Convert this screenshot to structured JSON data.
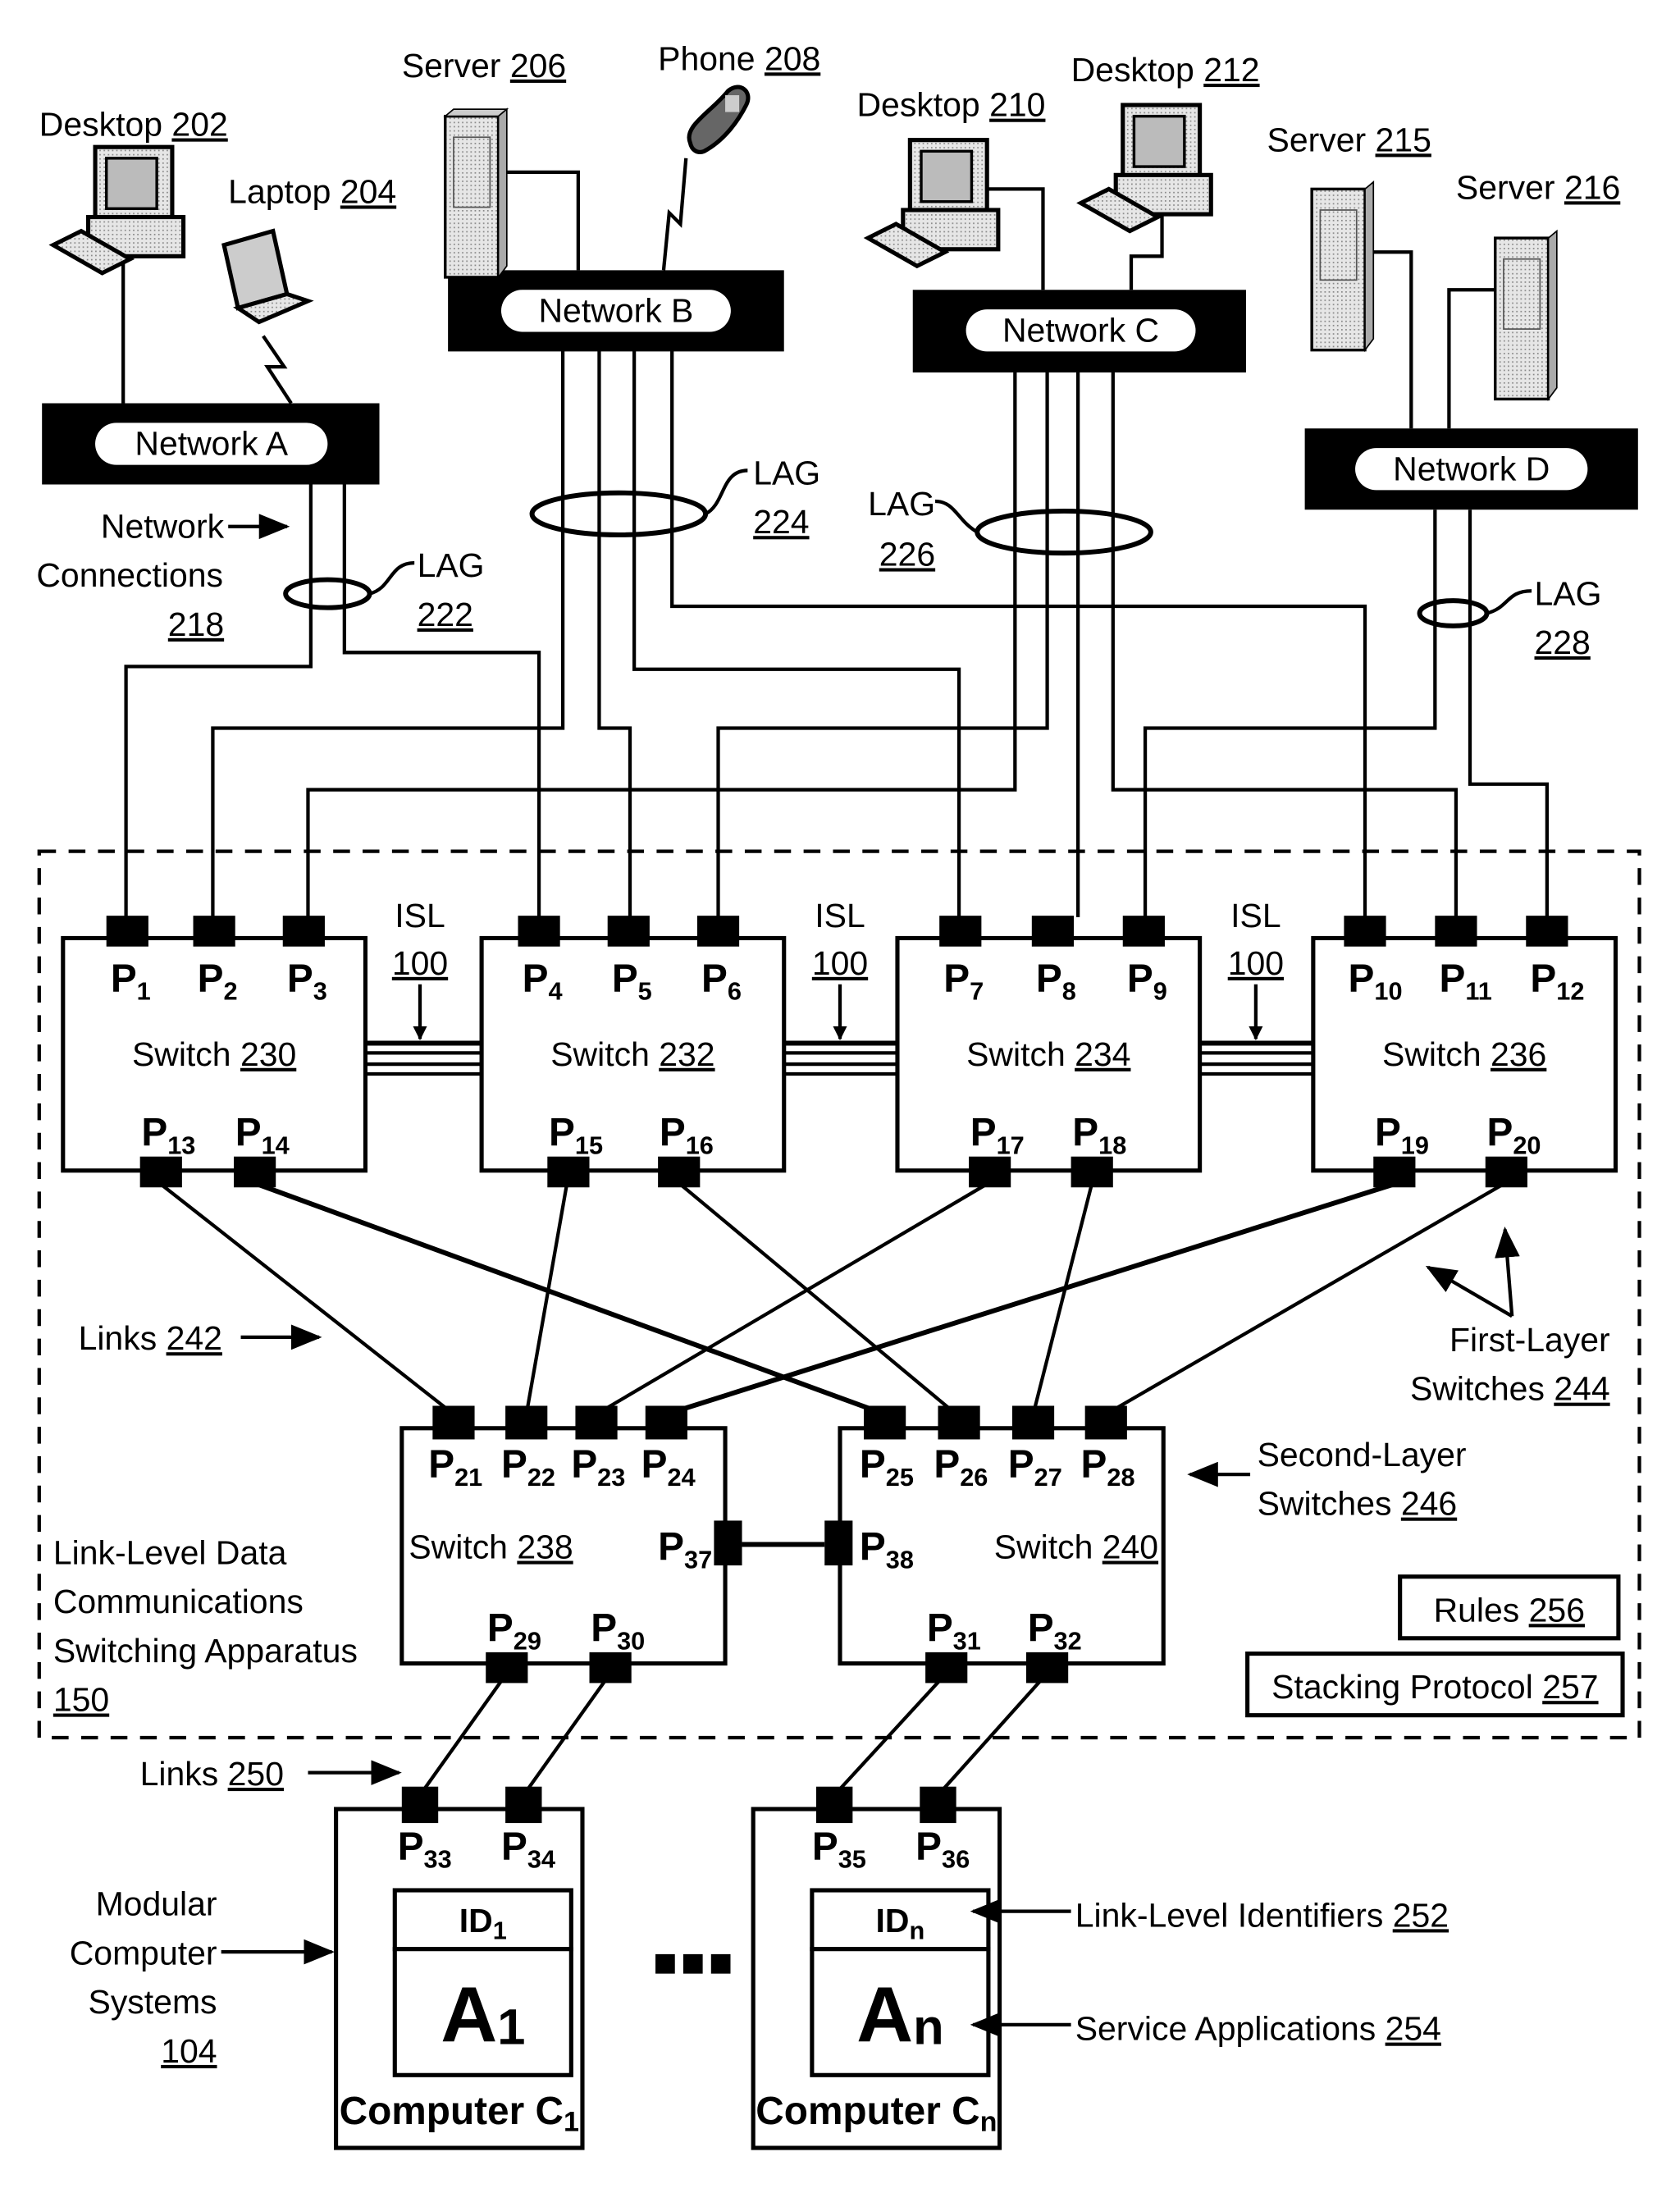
{
  "devices": [
    {
      "id": "desktop-202",
      "name": "Desktop",
      "ref": "202",
      "kind": "desktop"
    },
    {
      "id": "laptop-204",
      "name": "Laptop",
      "ref": "204",
      "kind": "laptop"
    },
    {
      "id": "server-206",
      "name": "Server",
      "ref": "206",
      "kind": "server"
    },
    {
      "id": "phone-208",
      "name": "Phone",
      "ref": "208",
      "kind": "phone"
    },
    {
      "id": "desktop-210",
      "name": "Desktop",
      "ref": "210",
      "kind": "desktop"
    },
    {
      "id": "desktop-212",
      "name": "Desktop",
      "ref": "212",
      "kind": "desktop"
    },
    {
      "id": "server-215",
      "name": "Server",
      "ref": "215",
      "kind": "server"
    },
    {
      "id": "server-216",
      "name": "Server",
      "ref": "216",
      "kind": "server"
    }
  ],
  "networks": [
    {
      "id": "network-a",
      "label": "Network A"
    },
    {
      "id": "network-b",
      "label": "Network B"
    },
    {
      "id": "network-c",
      "label": "Network C"
    },
    {
      "id": "network-d",
      "label": "Network D"
    }
  ],
  "lags": [
    {
      "label": "LAG",
      "ref": "222"
    },
    {
      "label": "LAG",
      "ref": "224"
    },
    {
      "label": "LAG",
      "ref": "226"
    },
    {
      "label": "LAG",
      "ref": "228"
    }
  ],
  "network_connections": {
    "line1": "Network",
    "line2": "Connections",
    "ref": "218"
  },
  "isl": {
    "label": "ISL",
    "ref": "100"
  },
  "first_layer_switches": [
    {
      "label": "Switch",
      "ref": "230",
      "top_ports": [
        "1",
        "2",
        "3"
      ],
      "bottom_ports": [
        "13",
        "14"
      ]
    },
    {
      "label": "Switch",
      "ref": "232",
      "top_ports": [
        "4",
        "5",
        "6"
      ],
      "bottom_ports": [
        "15",
        "16"
      ]
    },
    {
      "label": "Switch",
      "ref": "234",
      "top_ports": [
        "7",
        "8",
        "9"
      ],
      "bottom_ports": [
        "17",
        "18"
      ]
    },
    {
      "label": "Switch",
      "ref": "236",
      "top_ports": [
        "10",
        "11",
        "12"
      ],
      "bottom_ports": [
        "19",
        "20"
      ]
    }
  ],
  "second_layer_switches": [
    {
      "label": "Switch",
      "ref": "238",
      "top_ports": [
        "21",
        "22",
        "23",
        "24"
      ],
      "bottom_ports": [
        "29",
        "30"
      ],
      "side_port": "37"
    },
    {
      "label": "Switch",
      "ref": "240",
      "top_ports": [
        "25",
        "26",
        "27",
        "28"
      ],
      "bottom_ports": [
        "31",
        "32"
      ],
      "side_port": "38"
    }
  ],
  "port_prefix": "P",
  "links_242": {
    "label": "Links",
    "ref": "242"
  },
  "links_250": {
    "label": "Links",
    "ref": "250"
  },
  "first_layer_label": {
    "line1": "First-Layer",
    "line2": "Switches",
    "ref": "244"
  },
  "second_layer_label": {
    "line1": "Second-Layer",
    "line2": "Switches",
    "ref": "246"
  },
  "apparatus": {
    "line1": "Link-Level Data",
    "line2": "Communications",
    "line3": "Switching Apparatus",
    "ref": "150"
  },
  "rules": {
    "label": "Rules",
    "ref": "256"
  },
  "stacking": {
    "label": "Stacking Protocol",
    "ref": "257"
  },
  "computers": [
    {
      "ports": [
        "33",
        "34"
      ],
      "id_label": "ID",
      "id_sub": "1",
      "app_label": "A",
      "app_sub": "1",
      "name": "Computer C",
      "name_sub": "1"
    },
    {
      "ports": [
        "35",
        "36"
      ],
      "id_label": "ID",
      "id_sub": "n",
      "app_label": "A",
      "app_sub": "n",
      "name": "Computer C",
      "name_sub": "n"
    }
  ],
  "ellipsis": "▪▪▪",
  "modular": {
    "line1": "Modular",
    "line2": "Computer",
    "line3": "Systems",
    "ref": "104"
  },
  "link_level_ids": {
    "label": "Link-Level Identifiers",
    "ref": "252"
  },
  "service_apps": {
    "label": "Service Applications",
    "ref": "254"
  }
}
